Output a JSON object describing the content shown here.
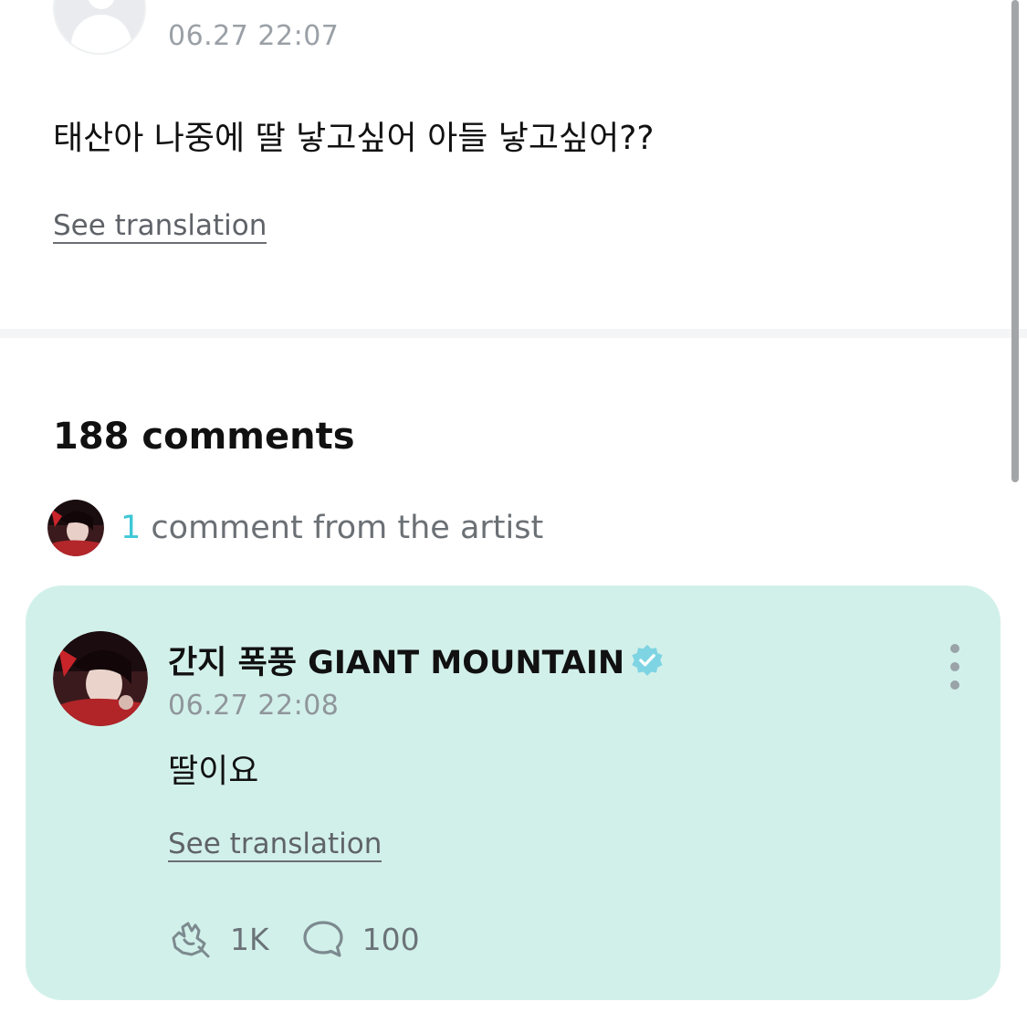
{
  "post": {
    "time": "06.27 22:07",
    "text": "태산아 나중에 딸 낳고싶어 아들 낳고싶어??",
    "translate_label": "See translation"
  },
  "comments": {
    "count_label": "188 comments",
    "artist_count": "1",
    "artist_label": " comment from the artist"
  },
  "artist_comment": {
    "author": "간지 폭풍 GIANT MOUNTAIN",
    "verified": true,
    "time": "06.27 22:08",
    "text": "딸이요",
    "translate_label": "See translation",
    "likes": "1K",
    "replies": "100"
  },
  "colors": {
    "accent": "#3fc8d6",
    "card_background": "#d2f0ea",
    "verified_badge": "#7fd4e3"
  },
  "icons": [
    "default-avatar-icon",
    "verified-badge-icon",
    "more-vertical-icon",
    "like-icon",
    "reply-icon"
  ]
}
